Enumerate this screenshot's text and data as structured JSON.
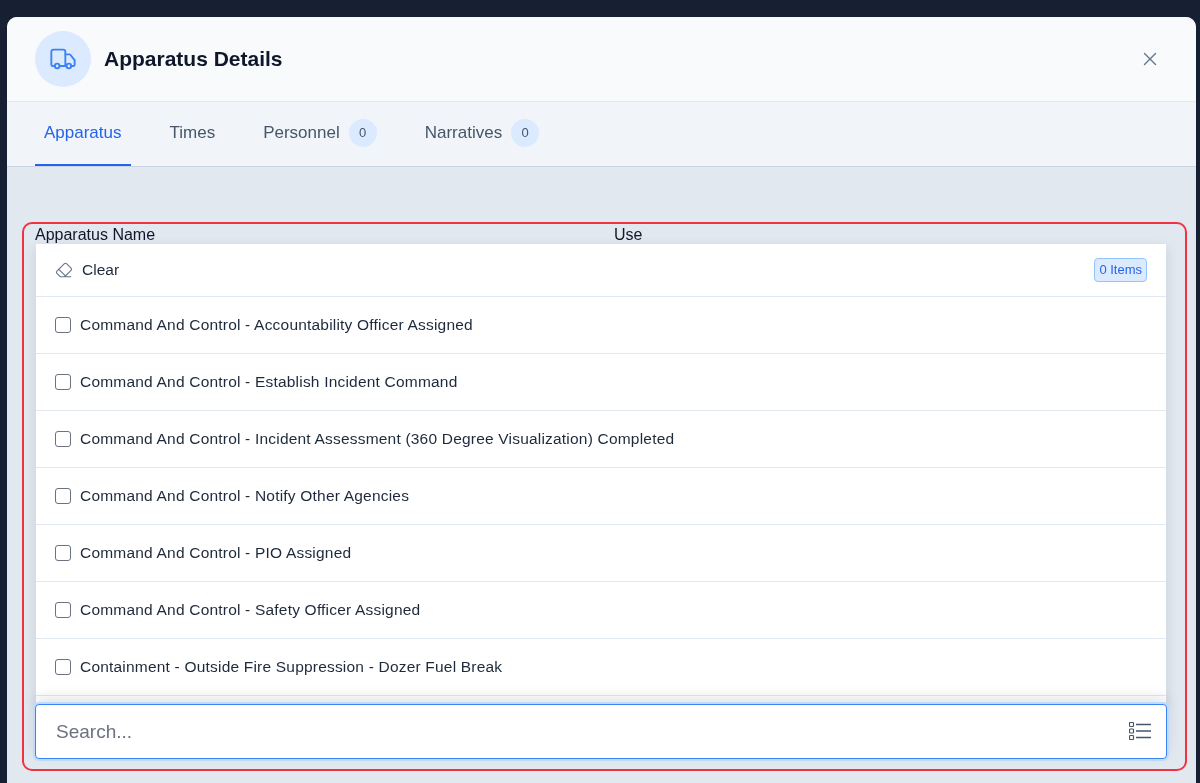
{
  "dialog": {
    "title": "Apparatus Details"
  },
  "tabs": [
    {
      "label": "Apparatus",
      "selected": true
    },
    {
      "label": "Times",
      "selected": false
    },
    {
      "label": "Personnel",
      "count": "0",
      "selected": false
    },
    {
      "label": "Narratives",
      "count": "0",
      "selected": false
    }
  ],
  "form": {
    "fields": [
      {
        "label": "Apparatus Name"
      },
      {
        "label": "Use"
      }
    ]
  },
  "dropdown": {
    "clear_label": "Clear",
    "count_badge": "0 Items",
    "options": [
      {
        "label": "Command And Control - Accountability Officer Assigned",
        "checked": false
      },
      {
        "label": "Command And Control - Establish Incident Command",
        "checked": false
      },
      {
        "label": "Command And Control - Incident Assessment (360 Degree Visualization) Completed",
        "checked": false
      },
      {
        "label": "Command And Control - Notify Other Agencies",
        "checked": false
      },
      {
        "label": "Command And Control - PIO Assigned",
        "checked": false
      },
      {
        "label": "Command And Control - Safety Officer Assigned",
        "checked": false
      },
      {
        "label": "Containment - Outside Fire Suppression - Dozer Fuel Break",
        "checked": false
      }
    ],
    "search": {
      "placeholder": "Search..."
    }
  }
}
